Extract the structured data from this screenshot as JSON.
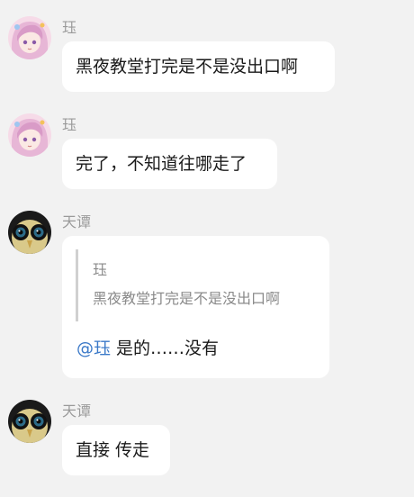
{
  "messages": [
    {
      "sender": "珏",
      "avatar": "anime-girl-pink-hair-avatar",
      "text": "黑夜教堂打完是不是没出口啊"
    },
    {
      "sender": "珏",
      "avatar": "anime-girl-pink-hair-avatar",
      "text": "完了，不知道往哪走了"
    },
    {
      "sender": "天谭",
      "avatar": "owl-avatar",
      "quote": {
        "sender": "珏",
        "text": "黑夜教堂打完是不是没出口啊"
      },
      "mention": "@珏",
      "text": " 是的……没有"
    },
    {
      "sender": "天谭",
      "avatar": "owl-avatar",
      "text": "直接 传走"
    }
  ],
  "colors": {
    "background": "#f2f2f2",
    "bubble": "#ffffff",
    "sender": "#9a9a9a",
    "mention": "#3b79c8"
  }
}
